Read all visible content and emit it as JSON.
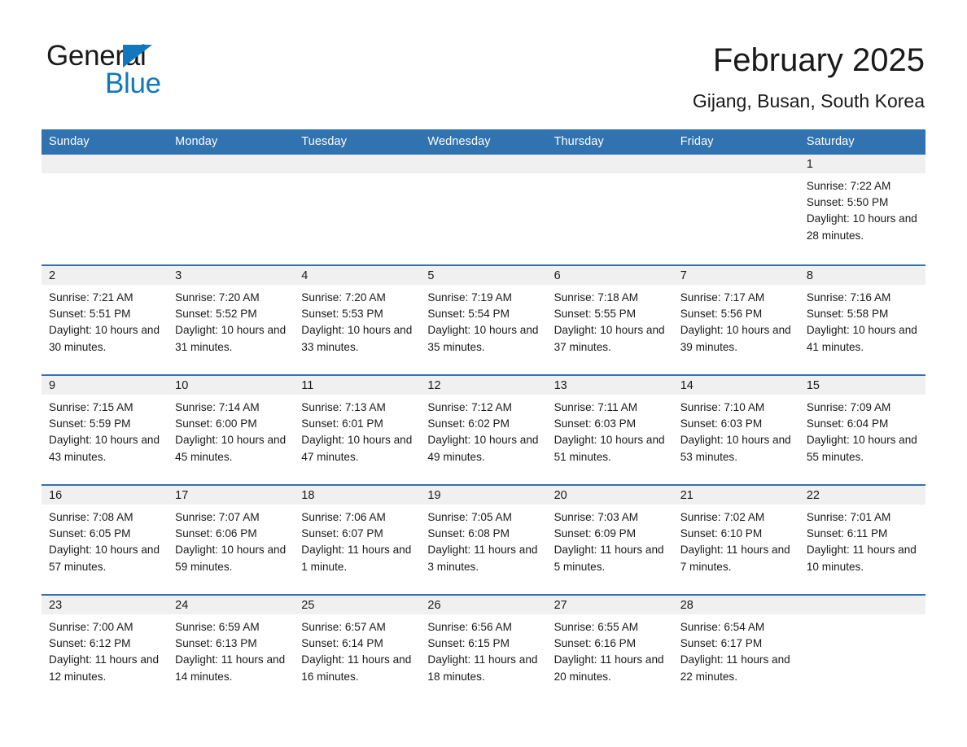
{
  "brand": {
    "name_line1": "General",
    "name_line2": "Blue",
    "accent_color": "#1278be",
    "header_color": "#3172b0"
  },
  "header": {
    "title": "February 2025",
    "subtitle": "Gijang, Busan, South Korea"
  },
  "calendar": {
    "weekday_headers": [
      "Sunday",
      "Monday",
      "Tuesday",
      "Wednesday",
      "Thursday",
      "Friday",
      "Saturday"
    ],
    "weeks": [
      [
        {
          "date": "",
          "sunrise": "",
          "sunset": "",
          "daylight": "",
          "blank": true
        },
        {
          "date": "",
          "sunrise": "",
          "sunset": "",
          "daylight": "",
          "blank": true
        },
        {
          "date": "",
          "sunrise": "",
          "sunset": "",
          "daylight": "",
          "blank": true
        },
        {
          "date": "",
          "sunrise": "",
          "sunset": "",
          "daylight": "",
          "blank": true
        },
        {
          "date": "",
          "sunrise": "",
          "sunset": "",
          "daylight": "",
          "blank": true
        },
        {
          "date": "",
          "sunrise": "",
          "sunset": "",
          "daylight": "",
          "blank": true
        },
        {
          "date": "1",
          "sunrise": "Sunrise: 7:22 AM",
          "sunset": "Sunset: 5:50 PM",
          "daylight": "Daylight: 10 hours and 28 minutes.",
          "blank": false
        }
      ],
      [
        {
          "date": "2",
          "sunrise": "Sunrise: 7:21 AM",
          "sunset": "Sunset: 5:51 PM",
          "daylight": "Daylight: 10 hours and 30 minutes.",
          "blank": false
        },
        {
          "date": "3",
          "sunrise": "Sunrise: 7:20 AM",
          "sunset": "Sunset: 5:52 PM",
          "daylight": "Daylight: 10 hours and 31 minutes.",
          "blank": false
        },
        {
          "date": "4",
          "sunrise": "Sunrise: 7:20 AM",
          "sunset": "Sunset: 5:53 PM",
          "daylight": "Daylight: 10 hours and 33 minutes.",
          "blank": false
        },
        {
          "date": "5",
          "sunrise": "Sunrise: 7:19 AM",
          "sunset": "Sunset: 5:54 PM",
          "daylight": "Daylight: 10 hours and 35 minutes.",
          "blank": false
        },
        {
          "date": "6",
          "sunrise": "Sunrise: 7:18 AM",
          "sunset": "Sunset: 5:55 PM",
          "daylight": "Daylight: 10 hours and 37 minutes.",
          "blank": false
        },
        {
          "date": "7",
          "sunrise": "Sunrise: 7:17 AM",
          "sunset": "Sunset: 5:56 PM",
          "daylight": "Daylight: 10 hours and 39 minutes.",
          "blank": false
        },
        {
          "date": "8",
          "sunrise": "Sunrise: 7:16 AM",
          "sunset": "Sunset: 5:58 PM",
          "daylight": "Daylight: 10 hours and 41 minutes.",
          "blank": false
        }
      ],
      [
        {
          "date": "9",
          "sunrise": "Sunrise: 7:15 AM",
          "sunset": "Sunset: 5:59 PM",
          "daylight": "Daylight: 10 hours and 43 minutes.",
          "blank": false
        },
        {
          "date": "10",
          "sunrise": "Sunrise: 7:14 AM",
          "sunset": "Sunset: 6:00 PM",
          "daylight": "Daylight: 10 hours and 45 minutes.",
          "blank": false
        },
        {
          "date": "11",
          "sunrise": "Sunrise: 7:13 AM",
          "sunset": "Sunset: 6:01 PM",
          "daylight": "Daylight: 10 hours and 47 minutes.",
          "blank": false
        },
        {
          "date": "12",
          "sunrise": "Sunrise: 7:12 AM",
          "sunset": "Sunset: 6:02 PM",
          "daylight": "Daylight: 10 hours and 49 minutes.",
          "blank": false
        },
        {
          "date": "13",
          "sunrise": "Sunrise: 7:11 AM",
          "sunset": "Sunset: 6:03 PM",
          "daylight": "Daylight: 10 hours and 51 minutes.",
          "blank": false
        },
        {
          "date": "14",
          "sunrise": "Sunrise: 7:10 AM",
          "sunset": "Sunset: 6:03 PM",
          "daylight": "Daylight: 10 hours and 53 minutes.",
          "blank": false
        },
        {
          "date": "15",
          "sunrise": "Sunrise: 7:09 AM",
          "sunset": "Sunset: 6:04 PM",
          "daylight": "Daylight: 10 hours and 55 minutes.",
          "blank": false
        }
      ],
      [
        {
          "date": "16",
          "sunrise": "Sunrise: 7:08 AM",
          "sunset": "Sunset: 6:05 PM",
          "daylight": "Daylight: 10 hours and 57 minutes.",
          "blank": false
        },
        {
          "date": "17",
          "sunrise": "Sunrise: 7:07 AM",
          "sunset": "Sunset: 6:06 PM",
          "daylight": "Daylight: 10 hours and 59 minutes.",
          "blank": false
        },
        {
          "date": "18",
          "sunrise": "Sunrise: 7:06 AM",
          "sunset": "Sunset: 6:07 PM",
          "daylight": "Daylight: 11 hours and 1 minute.",
          "blank": false
        },
        {
          "date": "19",
          "sunrise": "Sunrise: 7:05 AM",
          "sunset": "Sunset: 6:08 PM",
          "daylight": "Daylight: 11 hours and 3 minutes.",
          "blank": false
        },
        {
          "date": "20",
          "sunrise": "Sunrise: 7:03 AM",
          "sunset": "Sunset: 6:09 PM",
          "daylight": "Daylight: 11 hours and 5 minutes.",
          "blank": false
        },
        {
          "date": "21",
          "sunrise": "Sunrise: 7:02 AM",
          "sunset": "Sunset: 6:10 PM",
          "daylight": "Daylight: 11 hours and 7 minutes.",
          "blank": false
        },
        {
          "date": "22",
          "sunrise": "Sunrise: 7:01 AM",
          "sunset": "Sunset: 6:11 PM",
          "daylight": "Daylight: 11 hours and 10 minutes.",
          "blank": false
        }
      ],
      [
        {
          "date": "23",
          "sunrise": "Sunrise: 7:00 AM",
          "sunset": "Sunset: 6:12 PM",
          "daylight": "Daylight: 11 hours and 12 minutes.",
          "blank": false
        },
        {
          "date": "24",
          "sunrise": "Sunrise: 6:59 AM",
          "sunset": "Sunset: 6:13 PM",
          "daylight": "Daylight: 11 hours and 14 minutes.",
          "blank": false
        },
        {
          "date": "25",
          "sunrise": "Sunrise: 6:57 AM",
          "sunset": "Sunset: 6:14 PM",
          "daylight": "Daylight: 11 hours and 16 minutes.",
          "blank": false
        },
        {
          "date": "26",
          "sunrise": "Sunrise: 6:56 AM",
          "sunset": "Sunset: 6:15 PM",
          "daylight": "Daylight: 11 hours and 18 minutes.",
          "blank": false
        },
        {
          "date": "27",
          "sunrise": "Sunrise: 6:55 AM",
          "sunset": "Sunset: 6:16 PM",
          "daylight": "Daylight: 11 hours and 20 minutes.",
          "blank": false
        },
        {
          "date": "28",
          "sunrise": "Sunrise: 6:54 AM",
          "sunset": "Sunset: 6:17 PM",
          "daylight": "Daylight: 11 hours and 22 minutes.",
          "blank": false
        },
        {
          "date": "",
          "sunrise": "",
          "sunset": "",
          "daylight": "",
          "blank": true
        }
      ]
    ]
  }
}
